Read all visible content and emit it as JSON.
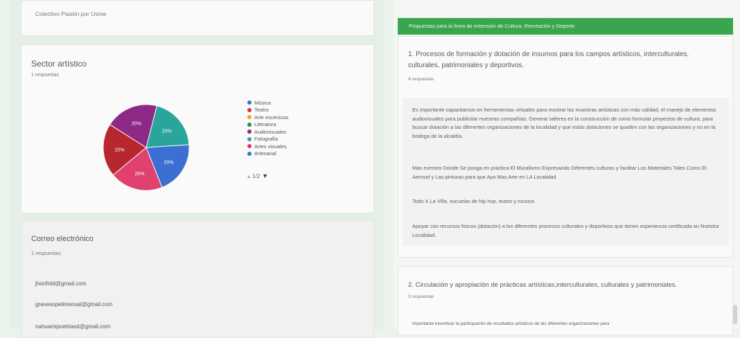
{
  "left": {
    "organization": "Colectivo Pasión por Usme",
    "sector": {
      "title": "Sector artístico",
      "responses": "1 respuestas",
      "legend": [
        {
          "label": "Música",
          "color": "#3b6fd1"
        },
        {
          "label": "Teatro",
          "color": "#c9373f"
        },
        {
          "label": "Arte escénicas",
          "color": "#f2a31b"
        },
        {
          "label": "Literatura",
          "color": "#1e9246"
        },
        {
          "label": "Audiovisuales",
          "color": "#8e2a86"
        },
        {
          "label": "Fotografía",
          "color": "#2aa59b"
        },
        {
          "label": "Artes visuales",
          "color": "#d9366e"
        },
        {
          "label": "Artesanal",
          "color": "#3b6fd1"
        }
      ],
      "pager": "1/2"
    },
    "email": {
      "title": "Correo electrónico",
      "responses": "1 respuestas",
      "entries": [
        "jhonfrdd@gmail.com",
        "gravesopelimensal@gmail.com",
        "nahuamipoetriasd@gmail.com"
      ]
    }
  },
  "chart_data": {
    "type": "pie",
    "slices": [
      {
        "label": "20%",
        "value": 20,
        "color": "#2aa59b"
      },
      {
        "label": "20%",
        "value": 20,
        "color": "#3b6fd1"
      },
      {
        "label": "20%",
        "value": 20,
        "color": "#e0416f"
      },
      {
        "label": "20%",
        "value": 20,
        "color": "#b8262f"
      },
      {
        "label": "20%",
        "value": 20,
        "color": "#8e2a86"
      }
    ]
  },
  "right": {
    "header": "Propuestas para la línea de extensión de Cultura, Recreación y Deporte",
    "q1": {
      "title": "1. Procesos de formación y dotación de insumos para los campos artísticos, interculturales, culturales, patrimoniales y deportivos.",
      "responses": "4 respuestas",
      "answers": [
        "Es importante capacitarnos en herramientas virtuales para mostrar las muestras artísticas con más calidad, el manejo de elementos audiovisuales para publicitar nuestras compañías. Generar talleres en la construcción de como formular proyectos de cultura, para buscar dotación a las diferentes organizaciones de la localidad y que estás dotaciones se queden con las organizaciones y no en la bodega de la alcaldía.",
        "Mas eventos Donde Se ponga en practica El Muralismo Expresando Diferentes culturas y facilitar Los Materiales Tales Como El Aerosol y Las pinturas para que Aya Mas Arte en LA Localidad",
        "Todo X La Villa, escuelas de hip hop, teatro y musica",
        "Apoyar con recursos físicos (dotación) a los diferentes procesos culturales y deportivos que tienen experiencia certificada en Nuestra Localidad."
      ]
    },
    "q2": {
      "title": "2. Circulación y apropiación de prácticas artísticas,interculturales, culturales y patrimoniales.",
      "responses": "3 respuestas",
      "preview": "Importante incentivar la participación de resultados artísticos de las diferentes organizaciones para"
    }
  }
}
